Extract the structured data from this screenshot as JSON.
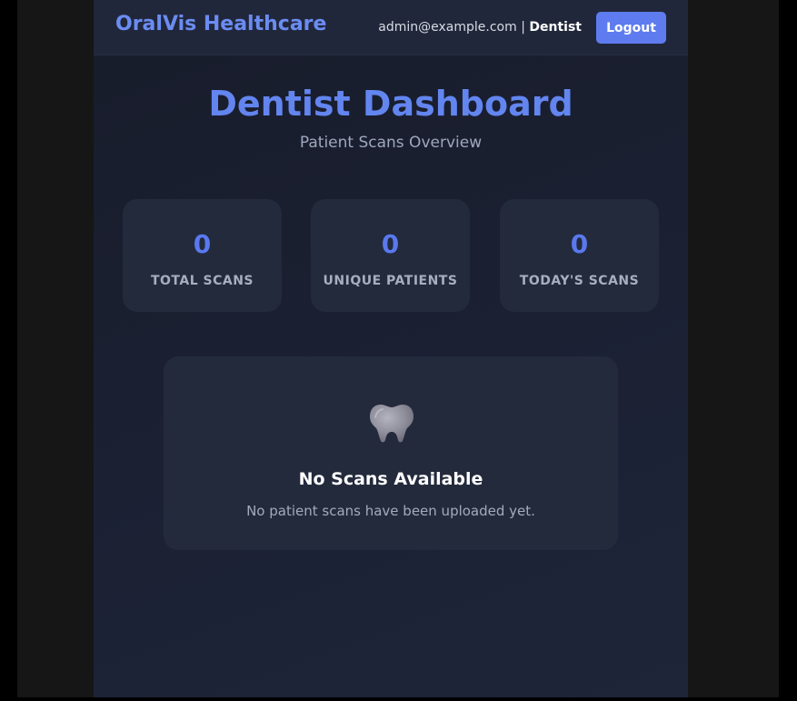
{
  "navbar": {
    "brand": "OralVis Healthcare",
    "user_email": "admin@example.com",
    "separator": "|",
    "user_role": "Dentist",
    "logout_label": "Logout"
  },
  "header": {
    "title": "Dentist Dashboard",
    "subtitle": "Patient Scans Overview"
  },
  "stats": [
    {
      "value": "0",
      "label": "TOTAL SCANS"
    },
    {
      "value": "0",
      "label": "UNIQUE PATIENTS"
    },
    {
      "value": "0",
      "label": "TODAY'S SCANS"
    }
  ],
  "empty_state": {
    "icon": "tooth-icon",
    "title": "No Scans Available",
    "message": "No patient scans have been uploaded yet."
  },
  "colors": {
    "accent": "#5e7cf0",
    "brand": "#6b8cf2",
    "background": "#1b2133",
    "card": "#232a3c"
  }
}
